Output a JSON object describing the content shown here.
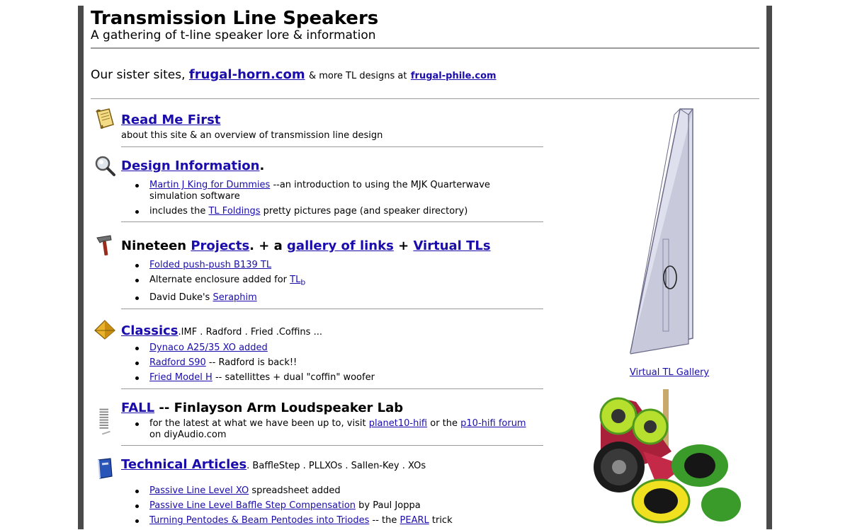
{
  "header": {
    "title": "Transmission Line Speakers",
    "subtitle": "A gathering of t-line speaker lore & information"
  },
  "sister": {
    "prefix": "Our sister sites,",
    "link1": "frugal-horn.com",
    "middle": "& more TL designs at",
    "link2": "frugal-phile.com"
  },
  "sections": {
    "readme": {
      "icon": "scroll-icon",
      "title": "Read Me First",
      "desc": "about this site & an overview of transmission line design"
    },
    "design": {
      "icon": "magnifier-icon",
      "title": "Design Information",
      "title_suffix": ".",
      "item1_link": "Martin J King for Dummies",
      "item1_text": " --an introduction to using the MJK Quarterwave simulation software",
      "item2_pre": "includes the ",
      "item2_link": "TL Foldings",
      "item2_post": " pretty pictures page (and speaker directory)"
    },
    "projects": {
      "icon": "hammer-icon",
      "lead": "Nineteen ",
      "link1": "Projects",
      "mid1": ". + a ",
      "link2": "gallery of links",
      "mid2": " + ",
      "link3": "Virtual TLs",
      "item1_link": "Folded push-push B139 TL",
      "item2_pre": "Alternate enclosure added for ",
      "item2_link": "TL",
      "item2_sub": "b",
      "item3_pre": "David Duke's ",
      "item3_link": "Seraphim"
    },
    "classics": {
      "icon": "pyramid-icon",
      "title": "Classics",
      "rest": ".IMF . Radford . Fried .Coffins ...",
      "item1_link": "Dynaco A25/35 XO added",
      "item2_link": "Radford S90",
      "item2_text": " -- Radford is back!!",
      "item3_link": "Fried Model H",
      "item3_text": " -- satellittes + dual \"coffin\" woofer"
    },
    "fall": {
      "icon": "spring-icon",
      "title": "FALL",
      "rest": " -- Finlayson Arm Loudspeaker Lab",
      "item1_pre": "for the latest at what we have been up to, visit ",
      "item1_link1": "planet10-hifi",
      "item1_mid": " or the ",
      "item1_link2": "p10-hifi forum",
      "item1_post": " on diyAudio.com"
    },
    "technical": {
      "icon": "book-icon",
      "title": "Technical Articles",
      "rest": ". BaffleStep . PLLXOs . Sallen-Key . XOs",
      "item1_link": "Passive Line Level XO",
      "item1_text": " spreadsheet added",
      "item2_link": "Passive Line Level Baffle Step Compensation",
      "item2_text": " by Paul Joppa",
      "item3_link": "Turning Pentodes & Beam Pentodes into Triodes",
      "item3_mid": " -- the ",
      "item3_link2": "PEARL",
      "item3_post": " trick"
    }
  },
  "sidebar": {
    "tl_caption": "Virtual TL Gallery"
  },
  "colors": {
    "link": "#1a0dab",
    "rule": "#9a9a9a",
    "frame": "#4a4a4a"
  }
}
